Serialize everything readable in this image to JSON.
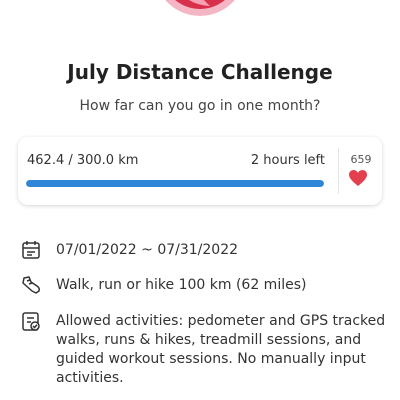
{
  "challenge": {
    "title": "July Distance Challenge",
    "subtitle": "How far can you go in one month?"
  },
  "progress": {
    "distance_text": "462.4 / 300.0 km",
    "progress_fraction": 1.0,
    "time_left": "2 hours left",
    "likes": "659"
  },
  "details": {
    "dates": "07/01/2022 ~ 07/31/2022",
    "goal": "Walk, run or hike 100 km (62 miles)",
    "allowed": "Allowed activities: pedometer and GPS tracked walks, runs & hikes, treadmill sessions, and guided workout sessions. No manually input activities."
  },
  "icons": {
    "badge": "challenge-badge-icon",
    "heart": "heart-icon",
    "calendar": "calendar-icon",
    "shoe": "shoe-icon",
    "checklist": "checklist-icon"
  },
  "colors": {
    "accent": "#2f86d6",
    "heart": "#e2404f",
    "badge_pink": "#f4b6c4",
    "badge_red": "#d8304a"
  }
}
